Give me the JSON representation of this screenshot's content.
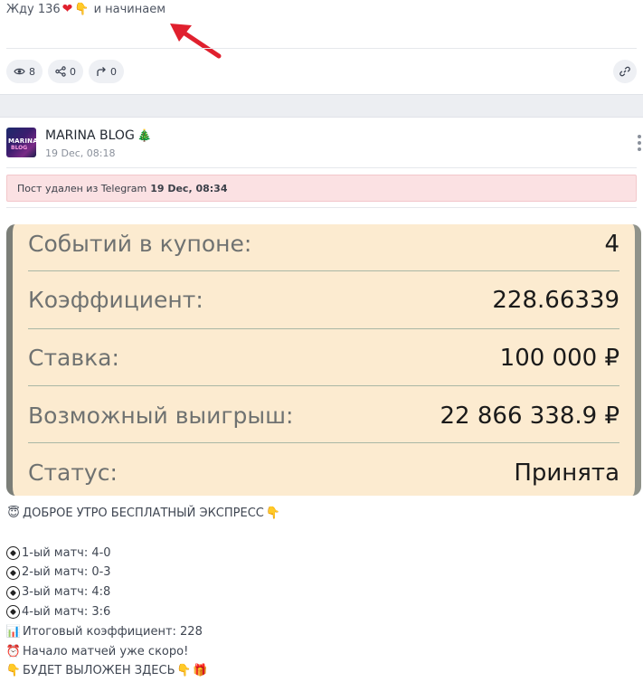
{
  "post_top": {
    "text_prefix": "Жду 136",
    "text_suffix": "и начинаем",
    "stats": {
      "views": "8",
      "shares": "0",
      "forwards": "0"
    }
  },
  "post": {
    "author_name": "MARINA BLOG",
    "author_date": "19 Dec, 08:18",
    "avatar_text_1": "MARINA",
    "avatar_text_2": "BLOG",
    "deleted_notice": "Пост удален из Telegram",
    "deleted_date": "19 Dec, 08:34"
  },
  "coupon": {
    "rows": [
      {
        "label": "Событий в купоне:",
        "value": "4"
      },
      {
        "label": "Коэффициент:",
        "value": "228.66339"
      },
      {
        "label": "Ставка:",
        "value": "100 000 ₽"
      },
      {
        "label": "Возможный выигрыш:",
        "value": "22 866 338.9 ₽"
      },
      {
        "label": "Статус:",
        "value": "Принята"
      }
    ]
  },
  "message": {
    "headline": "ДОБРОЕ УТРО БЕСПЛАТНЫЙ ЭКСПРЕСС",
    "matches": [
      "1-ый матч: 4-0",
      "2-ый матч: 0-3",
      "3-ый матч: 4:8",
      "4-ый матч: 3:6"
    ],
    "total": "Итоговый коэффициент: 228",
    "soon": "Начало матчей уже скоро!",
    "posted_here": "БУДЕТ ВЫЛОЖЕН ЗДЕСЬ"
  },
  "icons": {
    "heart": "heart-icon",
    "pointing_hand": "pointing-down-hand-icon",
    "eye": "eye-icon",
    "share": "share-icon",
    "forward": "forward-icon",
    "link": "link-icon",
    "tree": "christmas-tree-icon",
    "kebab": "more-vertical-icon",
    "smile": "smiling-face-icon",
    "ball": "soccer-ball-icon",
    "chart": "bar-chart-icon",
    "clock": "alarm-clock-icon",
    "gift": "gift-icon",
    "arrow": "red-arrow-annotation"
  },
  "colors": {
    "accent_red": "#e0202e",
    "coupon_bg": "#fcebd0",
    "deleted_bg": "#fbe1e3",
    "band_bg": "#eceef2"
  }
}
